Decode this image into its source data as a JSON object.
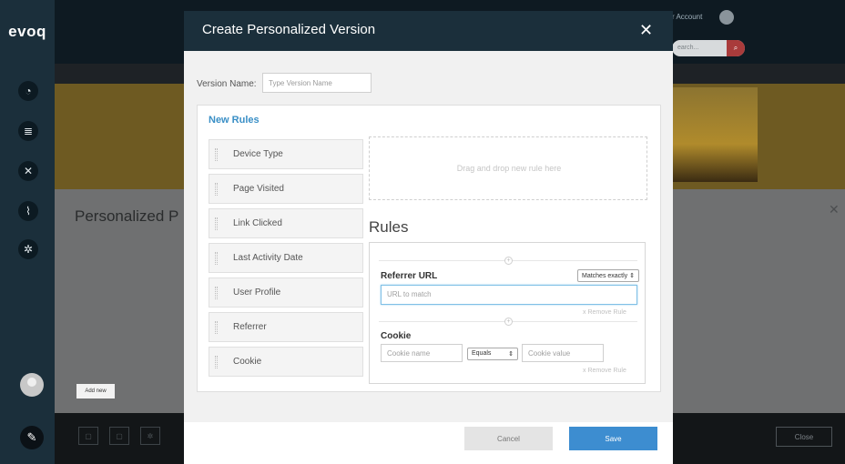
{
  "app": {
    "logo": "evoq",
    "account_link": "r Account",
    "search_placeholder": "earch...",
    "background_panel_title": "Personalized P",
    "add_new_label": "Add new",
    "close_label": "Close"
  },
  "nav": {
    "icons": [
      "gauge-icon",
      "content-icon",
      "tools-icon",
      "analytics-icon",
      "settings-icon"
    ]
  },
  "modal": {
    "title": "Create Personalized Version",
    "version_name_label": "Version Name:",
    "version_name_placeholder": "Type Version Name",
    "new_rules_title": "New Rules",
    "rule_types": [
      "Device Type",
      "Page Visited",
      "Link Clicked",
      "Last Activity Date",
      "User Profile",
      "Referrer",
      "Cookie"
    ],
    "dropzone_text": "Drag and drop new rule here",
    "rules_heading": "Rules",
    "rules": [
      {
        "title": "Referrer URL",
        "match_select": "Matches exactly",
        "input_placeholder": "URL to match",
        "remove_label": "x Remove Rule"
      },
      {
        "title": "Cookie",
        "name_placeholder": "Cookie name",
        "operator_select": "Equals",
        "value_placeholder": "Cookie value",
        "remove_label": "x Remove Rule"
      }
    ],
    "cancel_label": "Cancel",
    "save_label": "Save"
  },
  "colors": {
    "header": "#1b2f3b",
    "accent": "#3a8fc6",
    "save_button": "#3d8dd0"
  }
}
